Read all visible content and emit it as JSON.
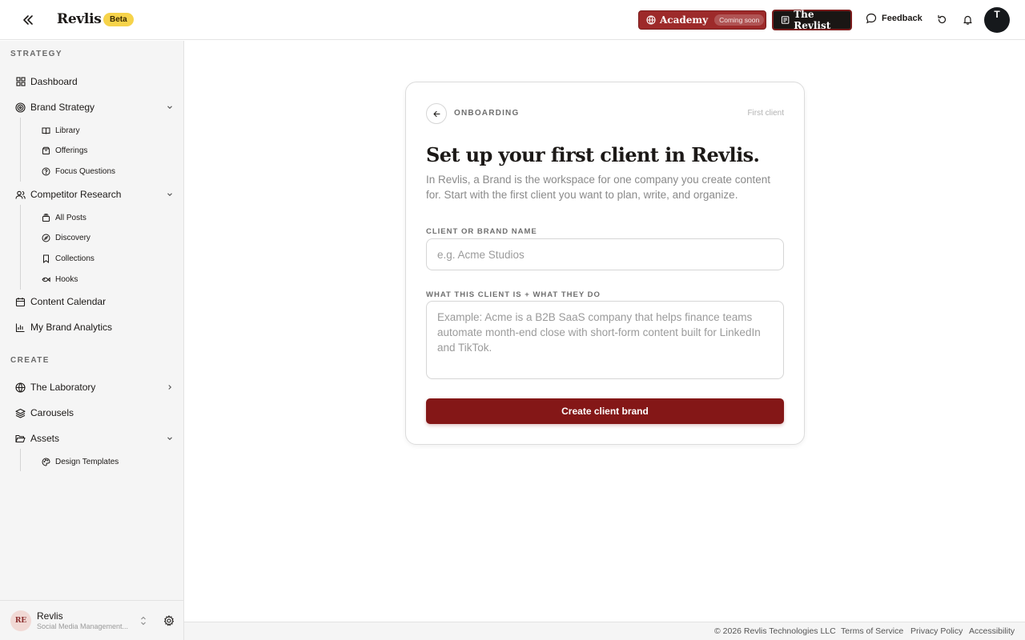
{
  "topbar": {
    "brand": "Revlis",
    "beta_badge": "Beta",
    "academy_label": "Academy",
    "academy_badge": "Coming soon",
    "revlist_label": "The Revlist",
    "feedback_label": "Feedback",
    "user_initial": "T"
  },
  "sidebar": {
    "strategy_label": "STRATEGY",
    "create_label": "CREATE",
    "items": {
      "dashboard": "Dashboard",
      "brand_strategy": "Brand Strategy",
      "library": "Library",
      "offerings": "Offerings",
      "focus_questions": "Focus Questions",
      "competitor_research": "Competitor Research",
      "all_posts": "All Posts",
      "discovery": "Discovery",
      "collections": "Collections",
      "hooks": "Hooks",
      "content_calendar": "Content Calendar",
      "my_brand_analytics": "My Brand Analytics",
      "the_laboratory": "The Laboratory",
      "carousels": "Carousels",
      "assets": "Assets",
      "design_templates": "Design Templates"
    },
    "workspace": {
      "initials": "RE",
      "name": "Revlis",
      "subtitle": "Social Media Management..."
    }
  },
  "onboarding": {
    "eyebrow": "ONBOARDING",
    "step": "First client",
    "headline": "Set up your first client in Revlis.",
    "description": "In Revlis, a Brand is the workspace for one company you create content for. Start with the first client you want to plan, write, and organize.",
    "name_label": "CLIENT OR BRAND NAME",
    "name_value": "",
    "name_placeholder": "e.g. Acme Studios",
    "about_label": "WHAT THIS CLIENT IS + WHAT THEY DO",
    "about_value": "",
    "about_placeholder": "Example: Acme is a B2B SaaS company that helps finance teams automate month-end close with short-form content built for LinkedIn and TikTok.",
    "submit_label": "Create client brand"
  },
  "footer": {
    "copyright": "© 2026 Revlis Technologies LLC",
    "terms": "Terms of Service",
    "privacy": "Privacy Policy",
    "accessibility": "Accessibility"
  },
  "colors": {
    "accent": "#841717",
    "academy": "#9d2a2a",
    "beta_badge": "#f6d34a",
    "sidebar_bg": "#f5f5f5"
  },
  "icons": {
    "collapse": "double-chevron-left-icon",
    "academy": "globe-icon",
    "revlist": "newspaper-icon",
    "feedback": "message-bubble-icon",
    "refresh": "refresh-icon",
    "bell": "bell-icon"
  }
}
